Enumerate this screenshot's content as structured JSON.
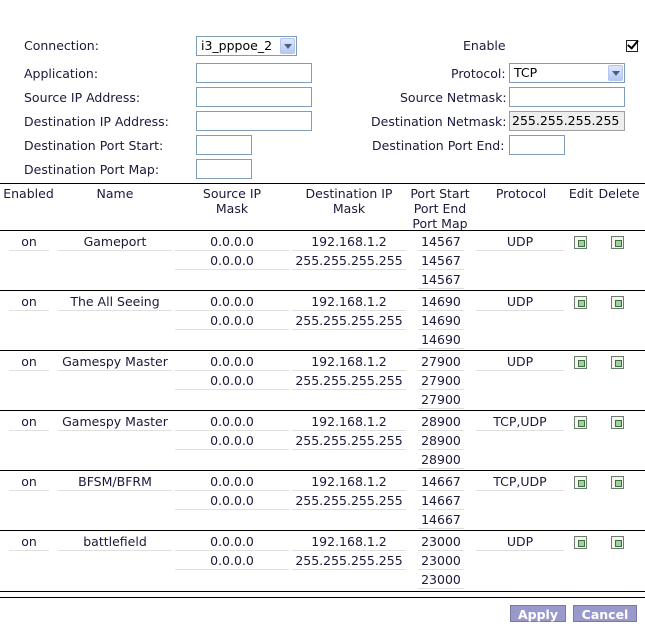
{
  "form": {
    "connection_label": "Connection:",
    "connection_value": "i3_pppoe_2",
    "enable_label": "Enable",
    "application_label": "Application:",
    "application_value": "",
    "protocol_label": "Protocol:",
    "protocol_value": "TCP",
    "source_ip_label": "Source IP Address:",
    "source_ip_value": "",
    "source_netmask_label": "Source Netmask:",
    "source_netmask_value": "",
    "dest_ip_label": "Destination IP Address:",
    "dest_ip_value": "",
    "dest_netmask_label": "Destination Netmask:",
    "dest_netmask_value": "255.255.255.255",
    "dest_port_start_label": "Destination Port Start:",
    "dest_port_start_value": "",
    "dest_port_end_label": "Destination Port End:",
    "dest_port_end_value": "",
    "dest_port_map_label": "Destination Port Map:",
    "dest_port_map_value": ""
  },
  "table": {
    "headers": {
      "enabled": "Enabled",
      "name": "Name",
      "source_ip": "Source IP",
      "source_mask": "Mask",
      "dest_ip": "Destination IP",
      "dest_mask": "Mask",
      "port_start": "Port Start",
      "port_end": "Port End",
      "port_map": "Port Map",
      "protocol": "Protocol",
      "edit": "Edit",
      "delete": "Delete"
    },
    "rows": [
      {
        "enabled": "on",
        "name": "Gameport",
        "src_ip": "0.0.0.0",
        "src_mask": "0.0.0.0",
        "dst_ip": "192.168.1.2",
        "dst_mask": "255.255.255.255",
        "port_start": "14567",
        "port_end": "14567",
        "port_map": "14567",
        "protocol": "UDP"
      },
      {
        "enabled": "on",
        "name": "The All Seeing",
        "src_ip": "0.0.0.0",
        "src_mask": "0.0.0.0",
        "dst_ip": "192.168.1.2",
        "dst_mask": "255.255.255.255",
        "port_start": "14690",
        "port_end": "14690",
        "port_map": "14690",
        "protocol": "UDP"
      },
      {
        "enabled": "on",
        "name": "Gamespy Master",
        "src_ip": "0.0.0.0",
        "src_mask": "0.0.0.0",
        "dst_ip": "192.168.1.2",
        "dst_mask": "255.255.255.255",
        "port_start": "27900",
        "port_end": "27900",
        "port_map": "27900",
        "protocol": "UDP"
      },
      {
        "enabled": "on",
        "name": "Gamespy Master",
        "src_ip": "0.0.0.0",
        "src_mask": "0.0.0.0",
        "dst_ip": "192.168.1.2",
        "dst_mask": "255.255.255.255",
        "port_start": "28900",
        "port_end": "28900",
        "port_map": "28900",
        "protocol": "TCP,UDP"
      },
      {
        "enabled": "on",
        "name": "BFSM/BFRM",
        "src_ip": "0.0.0.0",
        "src_mask": "0.0.0.0",
        "dst_ip": "192.168.1.2",
        "dst_mask": "255.255.255.255",
        "port_start": "14667",
        "port_end": "14667",
        "port_map": "14667",
        "protocol": "TCP,UDP"
      },
      {
        "enabled": "on",
        "name": "battlefield",
        "src_ip": "0.0.0.0",
        "src_mask": "0.0.0.0",
        "dst_ip": "192.168.1.2",
        "dst_mask": "255.255.255.255",
        "port_start": "23000",
        "port_end": "23000",
        "port_map": "23000",
        "protocol": "UDP"
      }
    ]
  },
  "actions": {
    "apply_label": "Apply",
    "cancel_label": "Cancel"
  },
  "icons": {
    "edit": "edit-icon",
    "delete": "delete-icon"
  }
}
